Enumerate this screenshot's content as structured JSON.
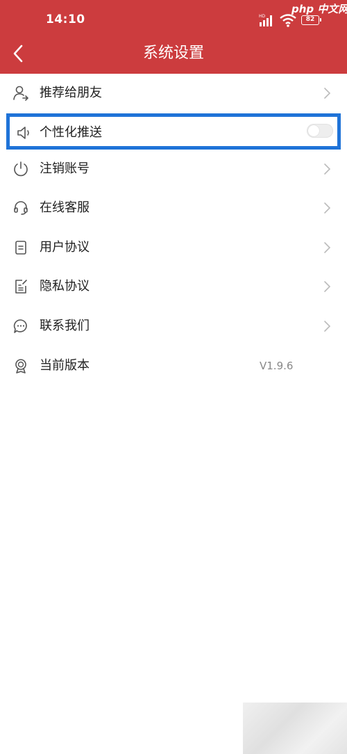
{
  "status_bar": {
    "time": "14:10",
    "battery": "82",
    "network_label": "HD"
  },
  "watermark": "php 中文网",
  "header": {
    "title": "系统设置",
    "back_icon": "chevron-left-icon"
  },
  "colors": {
    "header_bg": "#cc3c3e",
    "highlight_border": "#1f73d8",
    "label_text": "#222222",
    "value_text": "#888888"
  },
  "settings": {
    "items": [
      {
        "label": "推荐给朋友",
        "icon": "user-share-icon",
        "trailing": "chevron"
      },
      {
        "label": "个性化推送",
        "icon": "speaker-icon",
        "trailing": "toggle",
        "toggle_on": false
      },
      {
        "label": "注销账号",
        "icon": "power-icon",
        "trailing": "chevron"
      },
      {
        "label": "在线客服",
        "icon": "headset-icon",
        "trailing": "chevron"
      },
      {
        "label": "用户协议",
        "icon": "document-icon",
        "trailing": "chevron"
      },
      {
        "label": "隐私协议",
        "icon": "edit-document-icon",
        "trailing": "chevron"
      },
      {
        "label": "联系我们",
        "icon": "chat-bubble-icon",
        "trailing": "chevron"
      },
      {
        "label": "当前版本",
        "icon": "badge-icon",
        "trailing": "value",
        "value": "V1.9.6"
      }
    ]
  }
}
